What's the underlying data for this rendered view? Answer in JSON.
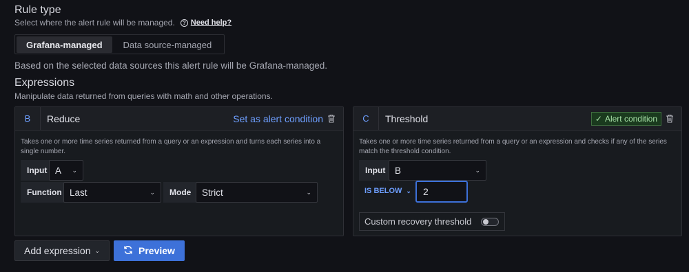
{
  "rule_type": {
    "title": "Rule type",
    "subtitle": "Select where the alert rule will be managed.",
    "help_link": "Need help?",
    "options": [
      "Grafana-managed",
      "Data source-managed"
    ],
    "selected": "Grafana-managed",
    "info": "Based on the selected data sources this alert rule will be Grafana-managed."
  },
  "expressions": {
    "title": "Expressions",
    "subtitle": "Manipulate data returned from queries with math and other operations.",
    "reduce": {
      "letter": "B",
      "title": "Reduce",
      "set_alert_label": "Set as alert condition",
      "description": "Takes one or more time series returned from a query or an expression and turns each series into a single number.",
      "input_label": "Input",
      "input_value": "A",
      "function_label": "Function",
      "function_value": "Last",
      "mode_label": "Mode",
      "mode_value": "Strict"
    },
    "threshold": {
      "letter": "C",
      "title": "Threshold",
      "alert_condition_label": "Alert condition",
      "description": "Takes one or more time series returned from a query or an expression and checks if any of the series match the threshold condition.",
      "input_label": "Input",
      "input_value": "B",
      "comparator": "IS BELOW",
      "threshold_value": "2",
      "recovery_label": "Custom recovery threshold",
      "recovery_enabled": false
    }
  },
  "actions": {
    "add_expression": "Add expression",
    "preview": "Preview"
  },
  "colors": {
    "accent": "#6e9fff",
    "primary_button": "#3d71d9",
    "alert_badge_bg": "#1a3a1e"
  }
}
